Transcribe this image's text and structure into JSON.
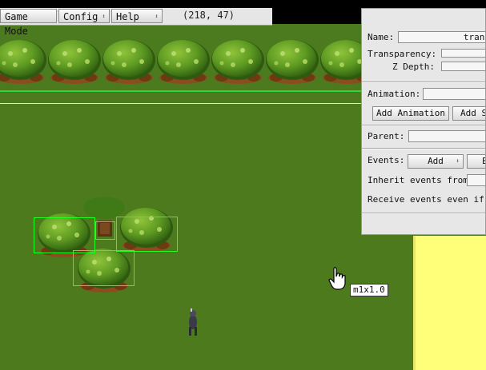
{
  "menubar": {
    "items": [
      {
        "label": "Game Mode"
      },
      {
        "label": "Config",
        "arrow": "⬍"
      },
      {
        "label": "Help",
        "arrow": "⬍"
      }
    ],
    "coords": "(218, 47)"
  },
  "inspector": {
    "name_label": "Name:",
    "name_value": "trans",
    "transparency_label": "Transparency:",
    "zdepth_label": "Z Depth:",
    "animation_label": "Animation:",
    "add_animation_button": "Add Animation",
    "add_second_button": "Add Se",
    "parent_label": "Parent:",
    "events_label": "Events:",
    "events_select": "Add",
    "events_second_button": "E",
    "inherit_label": "Inherit events from:",
    "receive_label": "Receive events even if ou"
  },
  "tooltip": "m1x1.0",
  "colors": {
    "grass": "#4e7a1e",
    "panel": "#e7e7e7",
    "sand": "#ffff7a",
    "selection": "#22ff22"
  },
  "icons": {
    "cursor": "hand-pointer-icon",
    "select_arrow": "updown-arrow-icon"
  }
}
